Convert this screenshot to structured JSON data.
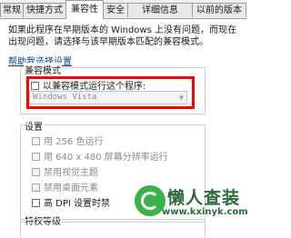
{
  "tabs": [
    "常规",
    "快捷方式",
    "兼容性",
    "安全",
    "详细信息",
    "以前的版本"
  ],
  "active_tab_index": 2,
  "intro_text": "如果此程序在早期版本的 Windows 上没有问题，而现在出现问题，请选择与该早期版本匹配的兼容模式。",
  "help_link": "帮助我选择设置",
  "compat_mode": {
    "group_label": "兼容模式",
    "checkbox_label": "以兼容模式运行这个程序:",
    "checked": false,
    "select_value": "Windows Vista"
  },
  "settings": {
    "group_label": "设置",
    "items": [
      {
        "label": "用 256 色运行",
        "checked": false,
        "enabled": false
      },
      {
        "label": "用 640 x 480 屏幕分辨率运行",
        "checked": false,
        "enabled": false
      },
      {
        "label": "禁用视觉主题",
        "checked": false,
        "enabled": false
      },
      {
        "label": "禁用桌面元素",
        "checked": false,
        "enabled": false
      },
      {
        "label": "高 DPI 设置时禁",
        "checked": false,
        "enabled": true
      }
    ]
  },
  "privilege": {
    "group_label": "特权等级"
  },
  "watermark": {
    "text": "懒人查装",
    "url": "www.kxinyk.com"
  },
  "colors": {
    "highlight": "#ff0000",
    "link": "#0a3f9c",
    "watermark_green": "#37b34a"
  }
}
